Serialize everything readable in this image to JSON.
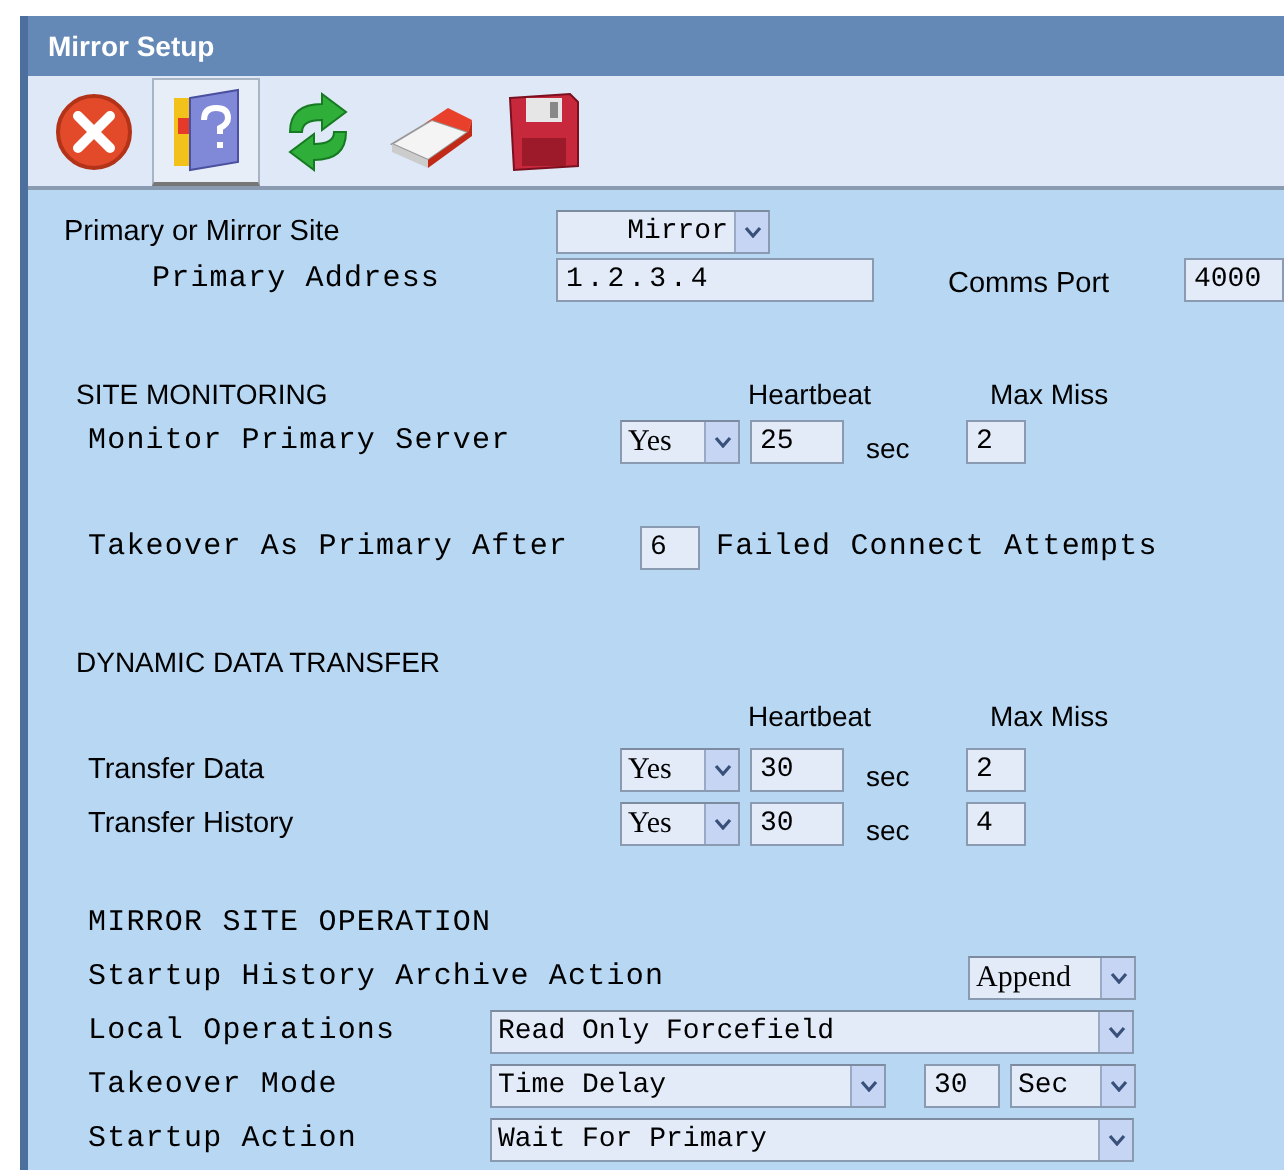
{
  "window": {
    "title": "Mirror Setup"
  },
  "toolbar": [
    {
      "kind": "close",
      "selected": false
    },
    {
      "kind": "help",
      "selected": true
    },
    {
      "kind": "refresh",
      "selected": false
    },
    {
      "kind": "erase",
      "selected": false
    },
    {
      "kind": "save",
      "selected": false
    }
  ],
  "site": {
    "label": "Primary or Mirror Site",
    "site_select": "Mirror",
    "address_label": "Primary Address",
    "address": "1.2.3.4",
    "port_label": "Comms Port",
    "port": "4000"
  },
  "site_monitoring": {
    "heading": "SITE MONITORING",
    "heartbeat_header": "Heartbeat",
    "max_miss_header": "Max Miss",
    "rows": [
      {
        "label": "Monitor Primary Server",
        "enabled": "Yes",
        "heartbeat": "25",
        "unit": "sec",
        "max_miss": "2"
      }
    ],
    "takeover": {
      "label": "Takeover As Primary After",
      "value": "6",
      "suffix": "Failed Connect Attempts"
    }
  },
  "dynamic_data_transfer": {
    "heading": "DYNAMIC DATA TRANSFER",
    "heartbeat_header": "Heartbeat",
    "max_miss_header": "Max Miss",
    "rows": [
      {
        "label": "Transfer Data",
        "enabled": "Yes",
        "heartbeat": "30",
        "unit": "sec",
        "max_miss": "2"
      },
      {
        "label": "Transfer History",
        "enabled": "Yes",
        "heartbeat": "30",
        "unit": "sec",
        "max_miss": "4"
      }
    ]
  },
  "mirror_site_operation": {
    "heading": "MIRROR SITE OPERATION",
    "archive_label": "Startup History Archive Action",
    "archive": "Append",
    "local_label": "Local Operations",
    "local": "Read Only Forcefield",
    "takeover_label": "Takeover Mode",
    "takeover": "Time Delay",
    "delay": "30",
    "delay_unit": "Sec",
    "startup_label": "Startup Action",
    "startup": "Wait For Primary"
  }
}
